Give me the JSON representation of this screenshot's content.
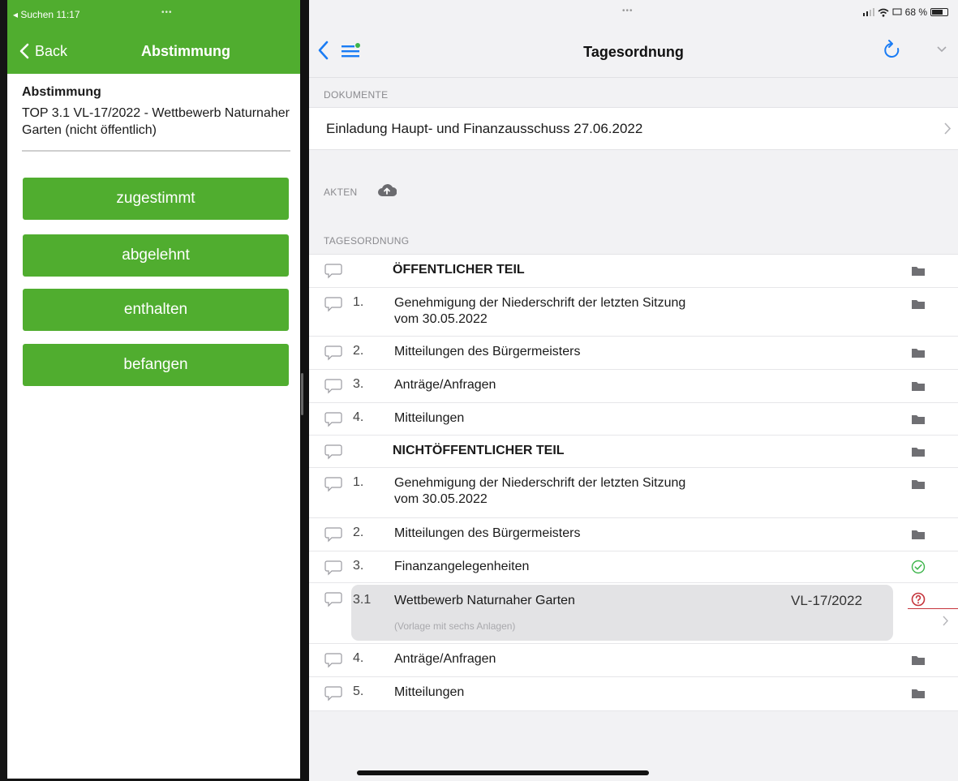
{
  "left": {
    "status_time": "◂ Suchen  11:17",
    "status_dots": "•••",
    "back_label": "Back",
    "nav_title": "Abstimmung",
    "info_heading": "Abstimmung",
    "info_text": "TOP 3.1 VL-17/2022 - Wettbewerb Naturnaher Garten (nicht öffentlich)",
    "buttons": {
      "approve": "zugestimmt",
      "reject": "abgelehnt",
      "abstain": "enthalten",
      "biased": "befangen"
    }
  },
  "right": {
    "status_dots": "•••",
    "battery": "68 %",
    "nav_title": "Tagesordnung",
    "sections": {
      "documents": "DOKUMENTE",
      "files": "AKTEN",
      "agenda": "TAGESORDNUNG"
    },
    "document": "Einladung Haupt- und Finanzausschuss 27.06.2022",
    "agenda": [
      {
        "num": "",
        "title": "ÖFFENTLICHER TEIL",
        "title2": "",
        "icon": "folder-icon"
      },
      {
        "num": "1.",
        "title": "Genehmigung der Niederschrift der letzten Sitzung",
        "title2": "vom 30.05.2022",
        "icon": "folder-icon"
      },
      {
        "num": "2.",
        "title": "Mitteilungen des Bürgermeisters",
        "title2": "",
        "icon": "folder-icon"
      },
      {
        "num": "3.",
        "title": "Anträge/Anfragen",
        "title2": "",
        "icon": "folder-icon"
      },
      {
        "num": "4.",
        "title": "Mitteilungen",
        "title2": "",
        "icon": "folder-icon"
      },
      {
        "num": "",
        "title": "NICHTÖFFENTLICHER TEIL",
        "title2": "",
        "icon": "folder-icon"
      },
      {
        "num": "1.",
        "title": "Genehmigung der Niederschrift der letzten Sitzung",
        "title2": "vom 30.05.2022",
        "icon": "folder-icon"
      },
      {
        "num": "2.",
        "title": "Mitteilungen des Bürgermeisters",
        "title2": "",
        "icon": "folder-icon"
      },
      {
        "num": "3.",
        "title": "Finanzangelegenheiten",
        "title2": "",
        "icon": "check-circle-icon"
      },
      {
        "num": "3.1",
        "title": "Wettbewerb Naturnaher Garten",
        "title2": "",
        "ref": "VL-17/2022",
        "subtitle": "(Vorlage mit sechs Anlagen)",
        "icon": "question-circle-icon"
      },
      {
        "num": "4.",
        "title": "Anträge/Anfragen",
        "title2": "",
        "icon": "folder-icon"
      },
      {
        "num": "5.",
        "title": "Mitteilungen",
        "title2": "",
        "icon": "folder-icon"
      }
    ]
  },
  "colors": {
    "brand_green": "#50ad2f",
    "accent_blue": "#1a7cf4",
    "check_green": "#3cb44a",
    "alert_red": "#c5343b"
  }
}
